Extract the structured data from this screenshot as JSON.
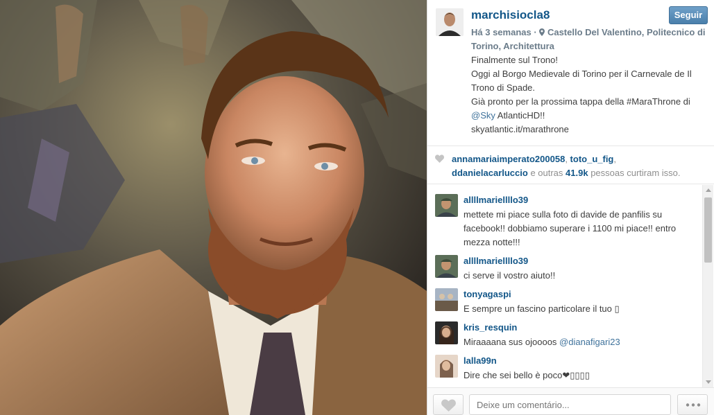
{
  "post": {
    "username": "marchisiocla8",
    "follow_label": "Seguir",
    "time_ago": "Há 3 semanas",
    "separator": "·",
    "location": "Castello Del Valentino, Politecnico di Torino, Architettura",
    "caption_lines": [
      "Finalmente sul Trono!",
      "Oggi al Borgo Medievale di Torino per il Carnevale de Il",
      "Trono di Spade.",
      "Già pronto per la prossima tappa della #MaraThrone di",
      "@Sky AtlanticHD!!",
      "skyatlantic.it/marathrone"
    ],
    "caption_mention": "@Sky",
    "caption_mention_rest": " AtlanticHD!!"
  },
  "likes": {
    "user1": "annamariaimperato200058",
    "sep1": ", ",
    "user2": "toto_u_fig",
    "sep2": ",",
    "user3": "ddanielacarluccio",
    "mid": " e outras ",
    "count": "41.9k",
    "tail": " pessoas curtiram isso."
  },
  "comments": [
    {
      "user": "allllmariellllo39",
      "text": "mettete mi piace sulla foto di davide de panfilis su facebook!! dobbiamo superare i 1100 mi piace!! entro mezza notte!!!"
    },
    {
      "user": "allllmariellllo39",
      "text": "ci serve il vostro aiuto!!"
    },
    {
      "user": "tonyagaspi",
      "text": "E sempre un fascino particolare il tuo ▯"
    },
    {
      "user": "kris_resquin",
      "text_before": "Miraaaana sus ojoooos ",
      "mention": "@dianafigari23"
    },
    {
      "user": "lalla99n",
      "text": "Dire che sei bello è poco❤▯▯▯▯"
    }
  ],
  "footer": {
    "comment_placeholder": "Deixe um comentário...",
    "like_icon": "heart-icon",
    "more_icon": "more-options-icon"
  },
  "colors": {
    "username": "#125688",
    "mention": "#3f729b",
    "follow_button": "#4a7fab",
    "meta": "#6b7c8a"
  }
}
